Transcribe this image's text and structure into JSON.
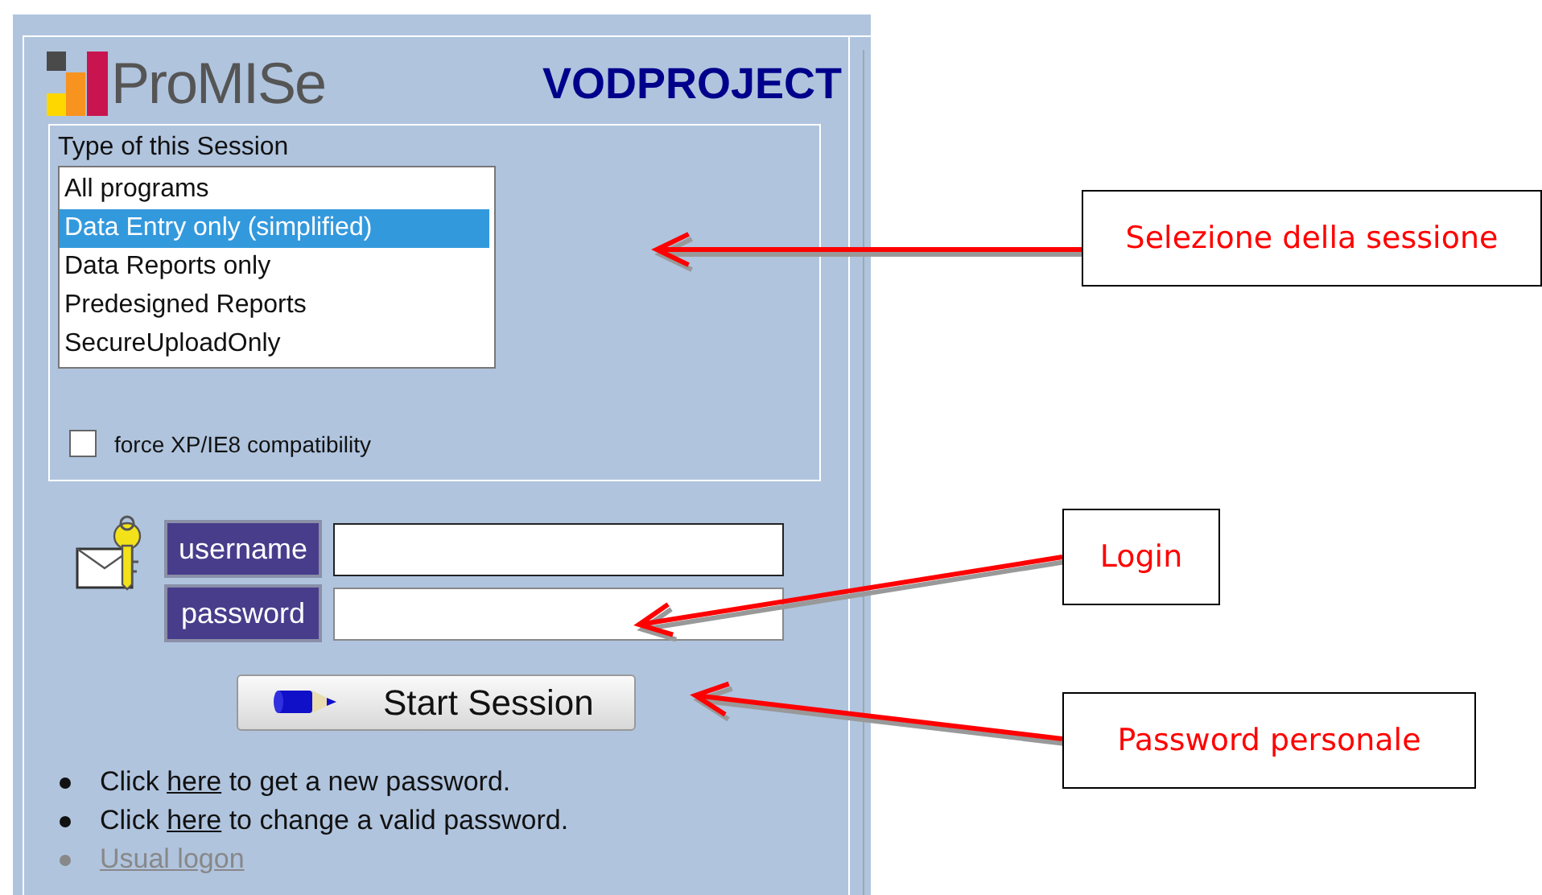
{
  "header": {
    "logo": "ProMISe",
    "project": "VODPROJECT"
  },
  "session": {
    "legend": "Type of this Session",
    "options": [
      {
        "label": "All programs",
        "selected": false
      },
      {
        "label": "Data Entry only (simplified)",
        "selected": true
      },
      {
        "label": "Data Reports only",
        "selected": false
      },
      {
        "label": "Predesigned Reports",
        "selected": false
      },
      {
        "label": "SecureUploadOnly",
        "selected": false
      }
    ],
    "compat": {
      "label": "force XP/IE8 compatibility",
      "checked": false
    }
  },
  "login": {
    "fields": [
      {
        "label": "username",
        "focused": true
      },
      {
        "label": "password",
        "focused": false
      }
    ],
    "button": "Start Session"
  },
  "links": [
    {
      "before": "Click ",
      "link": "here",
      "after": " to get a new password.",
      "disabled": false
    },
    {
      "before": "Click ",
      "link": "here",
      "after": " to change a valid password.",
      "disabled": false
    },
    {
      "link": "Usual logon",
      "disabled": true
    }
  ],
  "callouts": [
    {
      "text": "Selezione della sessione"
    },
    {
      "text": "Login"
    },
    {
      "text": "Password personale"
    }
  ]
}
